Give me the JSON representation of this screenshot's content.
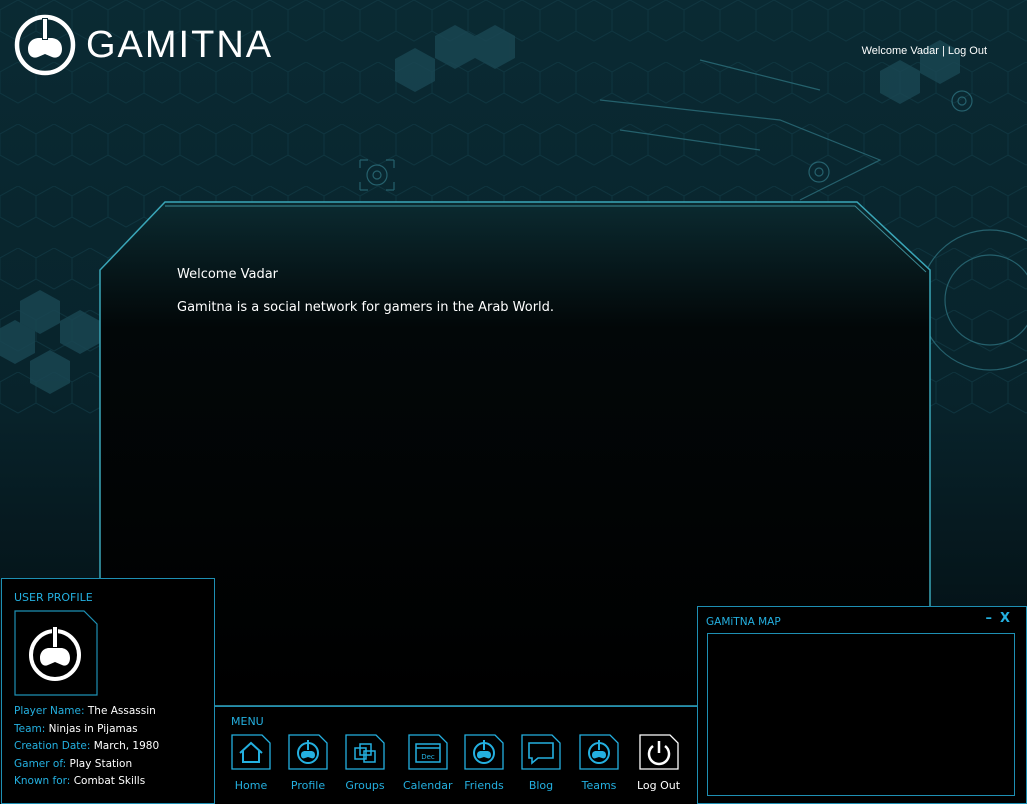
{
  "brand": {
    "name": "GAMITNA"
  },
  "topbar": {
    "welcome": "Welcome Vadar",
    "separator": "|",
    "logout": "Log Out"
  },
  "main": {
    "welcome": "Welcome Vadar",
    "tagline": "Gamitna is a social network for gamers in the Arab World."
  },
  "profile": {
    "title": "USER PROFILE",
    "fields": [
      {
        "key": "Player Name:",
        "value": "The Assassin"
      },
      {
        "key": "Team:",
        "value": "Ninjas in Pijamas"
      },
      {
        "key": "Creation Date:",
        "value": "March, 1980"
      },
      {
        "key": "Gamer of:",
        "value": "Play Station"
      },
      {
        "key": "Known for:",
        "value": "Combat Skills"
      }
    ]
  },
  "menu": {
    "title": "MENU",
    "items": [
      {
        "label": "Home",
        "icon": "home-icon"
      },
      {
        "label": "Profile",
        "icon": "profile-icon"
      },
      {
        "label": "Groups",
        "icon": "groups-icon"
      },
      {
        "label": "Calendar",
        "icon": "calendar-icon",
        "icon_text": "Dec"
      },
      {
        "label": "Friends",
        "icon": "friends-icon"
      },
      {
        "label": "Blog",
        "icon": "blog-icon"
      },
      {
        "label": "Teams",
        "icon": "teams-icon"
      },
      {
        "label": "Log Out",
        "icon": "power-icon"
      }
    ]
  },
  "map": {
    "title": "GAMiTNA MAP",
    "minimize": "–",
    "close": "X"
  },
  "colors": {
    "accent": "#24b0e0",
    "panel_border": "#1e8fb3",
    "background": "#000000"
  }
}
